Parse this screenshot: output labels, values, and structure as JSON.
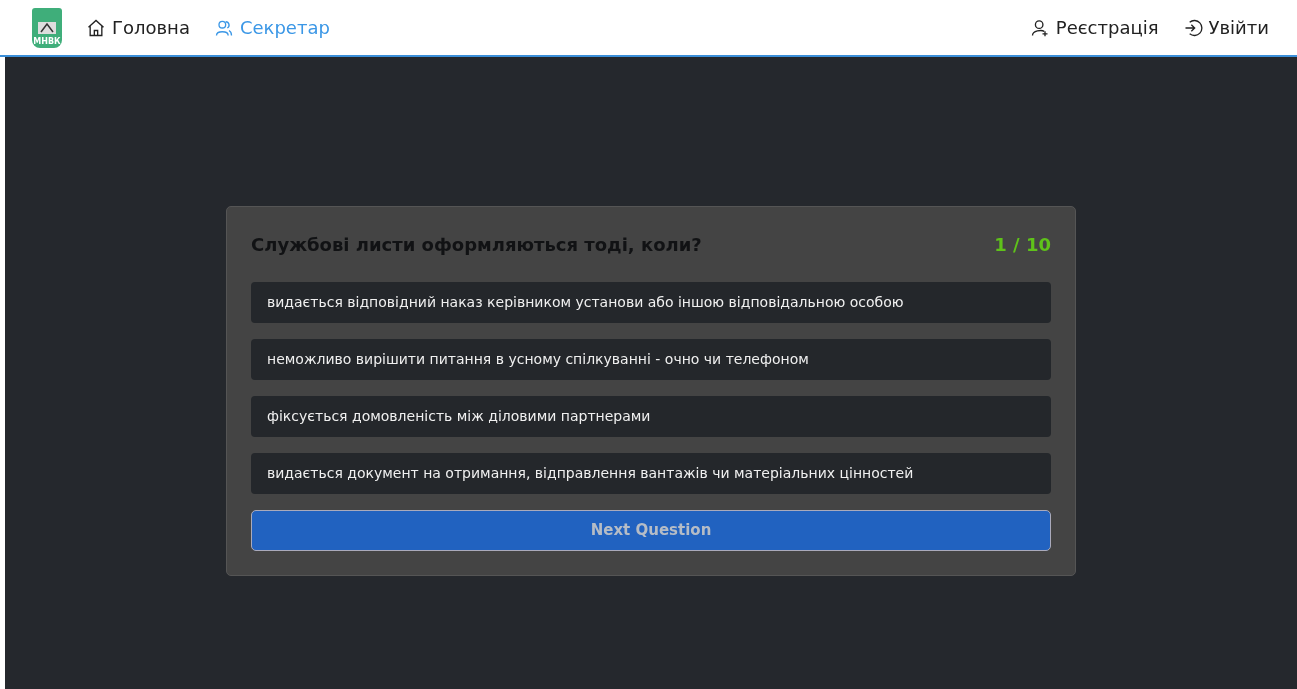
{
  "logo": {
    "text": "МНВК"
  },
  "nav_left": [
    {
      "label": "Головна",
      "selected": false
    },
    {
      "label": "Секретар",
      "selected": true
    }
  ],
  "nav_right": [
    {
      "label": "Реєстрація"
    },
    {
      "label": "Увійти"
    }
  ],
  "quiz": {
    "question": "Службові листи оформляються тоді, коли?",
    "counter": "1 / 10",
    "answers": [
      {
        "text": "видається відповідний наказ керівником установи або іншою відповідальною особою"
      },
      {
        "text": "неможливо вирішити питання в усному спілкуванні - очно чи телефоном"
      },
      {
        "text": "фіксується домовленість між діловими партнерами"
      },
      {
        "text": "видається документ на отримання, відправлення вантажів чи матеріальних цінностей"
      }
    ],
    "next_button": {
      "label": "Next Question",
      "disabled": true
    }
  }
}
